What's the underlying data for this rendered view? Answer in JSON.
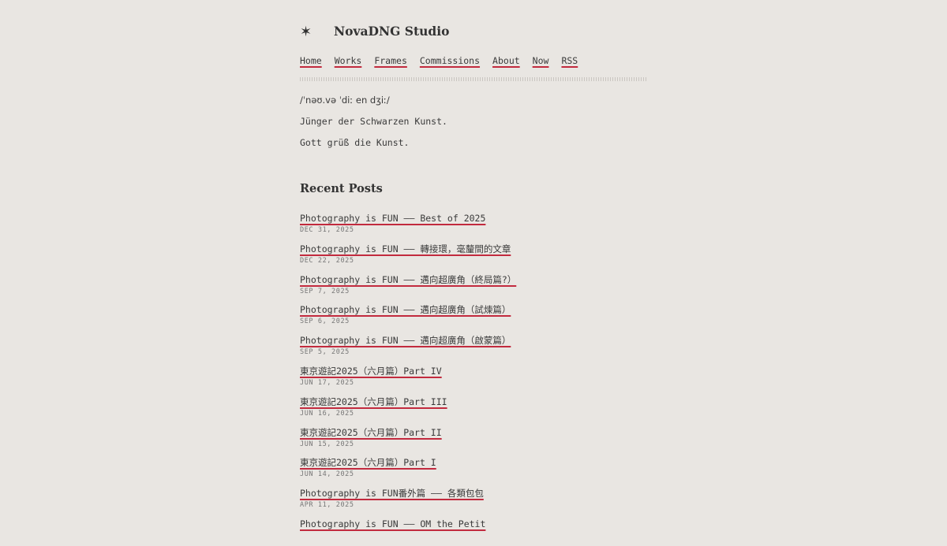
{
  "site": {
    "logo_glyph": "✶",
    "title": "NovaDNG Studio"
  },
  "nav": [
    "Home",
    "Works",
    "Frames",
    "Commissions",
    "About",
    "Now",
    "RSS"
  ],
  "intro": {
    "pronunciation": "/ˈnəʊ.və ˈdiː en dʒiː/",
    "line1": "Jünger der Schwarzen Kunst.",
    "line2": "Gott grüß die Kunst."
  },
  "recent": {
    "heading": "Recent Posts",
    "posts": [
      {
        "title": "Photography is FUN —— Best of 2025",
        "date": "DEC 31, 2025"
      },
      {
        "title": "Photography is FUN —— 轉接環，毫釐間的文章",
        "date": "DEC 22, 2025"
      },
      {
        "title": "Photography is FUN —— 邁向超廣角（終局篇?）",
        "date": "SEP 7, 2025"
      },
      {
        "title": "Photography is FUN —— 邁向超廣角（試煉篇）",
        "date": "SEP 6, 2025"
      },
      {
        "title": "Photography is FUN —— 邁向超廣角（啟蒙篇）",
        "date": "SEP 5, 2025"
      },
      {
        "title": "東京遊記2025（六月篇）Part IV",
        "date": "JUN 17, 2025"
      },
      {
        "title": "東京遊記2025（六月篇）Part III",
        "date": "JUN 16, 2025"
      },
      {
        "title": "東京遊記2025（六月篇）Part II",
        "date": "JUN 15, 2025"
      },
      {
        "title": "東京遊記2025（六月篇）Part I",
        "date": "JUN 14, 2025"
      },
      {
        "title": "Photography is FUN番外篇 —— 各類包包",
        "date": "APR 11, 2025"
      },
      {
        "title": "Photography is FUN —— OM the Petit",
        "date": ""
      }
    ]
  },
  "colors": {
    "background": "#e9e6e2",
    "text": "#3a3a3a",
    "accent_underline": "#c22a3e",
    "date": "#777777"
  }
}
